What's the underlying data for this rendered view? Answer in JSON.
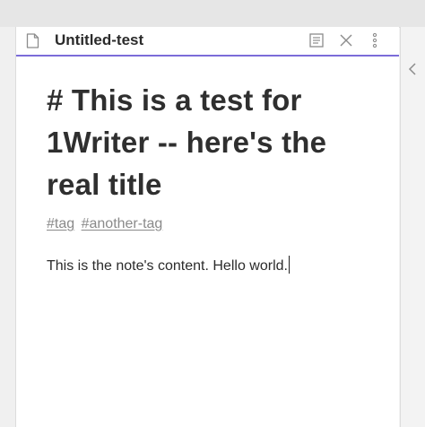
{
  "tab": {
    "title": "Untitled-test"
  },
  "note": {
    "heading": "# This is a test for 1Writer -- here's the real title",
    "tags": [
      "#tag",
      "#another-tag"
    ],
    "content": "This is the note's content. Hello world."
  },
  "icons": {
    "file": "file-icon",
    "reading_view": "reading-view-icon",
    "close": "close-icon",
    "more": "more-options-icon",
    "collapse": "chevron-left-icon"
  },
  "colors": {
    "active_tab_underline": "#7b6cd9",
    "tag_text": "#8a8a8a",
    "text": "#2b2b2b"
  }
}
